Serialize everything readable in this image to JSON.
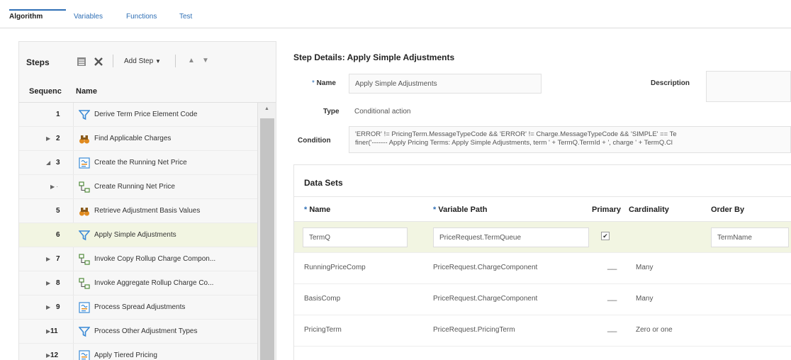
{
  "tabs": [
    "Algorithm",
    "Variables",
    "Functions",
    "Test"
  ],
  "steps": {
    "title": "Steps",
    "add_step_label": "Add Step",
    "columns": {
      "sequence": "Sequenc",
      "name": "Name"
    },
    "rows": [
      {
        "seq": "1",
        "expander": "",
        "icon": "filter-icon",
        "name": "Derive Term Price Element Code",
        "selected": false
      },
      {
        "seq": "2",
        "expander": "▶",
        "icon": "binoculars-icon",
        "name": "Find Applicable Charges",
        "selected": false
      },
      {
        "seq": "3",
        "expander": "◢",
        "icon": "process-icon",
        "name": "Create the Running Net Price",
        "selected": false
      },
      {
        "seq": "",
        "expander": "▶ ·",
        "icon": "hierarchy-icon",
        "name": "Create Running Net Price",
        "selected": false
      },
      {
        "seq": "5",
        "expander": "",
        "icon": "binoculars-icon",
        "name": "Retrieve Adjustment Basis Values",
        "selected": false
      },
      {
        "seq": "6",
        "expander": "",
        "icon": "filter-icon",
        "name": "Apply Simple Adjustments",
        "selected": true
      },
      {
        "seq": "7",
        "expander": "▶",
        "icon": "hierarchy-icon",
        "name": "Invoke Copy Rollup Charge Compon...",
        "selected": false
      },
      {
        "seq": "8",
        "expander": "▶",
        "icon": "hierarchy-icon",
        "name": "Invoke Aggregate Rollup Charge Co...",
        "selected": false
      },
      {
        "seq": "9",
        "expander": "▶",
        "icon": "process-icon",
        "name": "Process Spread Adjustments",
        "selected": false
      },
      {
        "seq": "11",
        "expander": "▶",
        "icon": "filter-icon",
        "name": "Process Other Adjustment Types",
        "selected": false
      },
      {
        "seq": "12",
        "expander": "▶",
        "icon": "process-icon",
        "name": "Apply Tiered Pricing",
        "selected": false
      }
    ]
  },
  "details": {
    "title": "Step Details: Apply Simple Adjustments",
    "name_label": "Name",
    "name_value": "Apply Simple Adjustments",
    "description_label": "Description",
    "description_value": "",
    "type_label": "Type",
    "type_value": "Conditional action",
    "condition_label": "Condition",
    "condition_line1": "'ERROR' != PricingTerm.MessageTypeCode && 'ERROR' != Charge.MessageTypeCode && 'SIMPLE' == Te",
    "condition_line2": "finer('------- Apply Pricing Terms: Apply Simple Adjustments, term ' + TermQ.TermId + ', charge ' + TermQ.Cl"
  },
  "data_sets": {
    "title": "Data Sets",
    "columns": {
      "name": "Name",
      "variable_path": "Variable Path",
      "primary": "Primary",
      "cardinality": "Cardinality",
      "order_by": "Order By"
    },
    "rows": [
      {
        "name": "TermQ",
        "path": "PriceRequest.TermQueue",
        "primary": true,
        "cardinality": "",
        "order_by": "TermName",
        "editable": true
      },
      {
        "name": "RunningPriceComp",
        "path": "PriceRequest.ChargeComponent",
        "primary": false,
        "cardinality": "Many",
        "order_by": "",
        "editable": false
      },
      {
        "name": "BasisComp",
        "path": "PriceRequest.ChargeComponent",
        "primary": false,
        "cardinality": "Many",
        "order_by": "",
        "editable": false
      },
      {
        "name": "PricingTerm",
        "path": "PriceRequest.PricingTerm",
        "primary": false,
        "cardinality": "Zero or one",
        "order_by": "",
        "editable": false
      }
    ]
  },
  "colors": {
    "accent": "#2f6fb5",
    "selected_row": "#f2f5e2",
    "filter_icon": "#3a8ad6",
    "binoculars_icon": "#e08a1e",
    "hierarchy_icon": "#4f8a3a"
  }
}
